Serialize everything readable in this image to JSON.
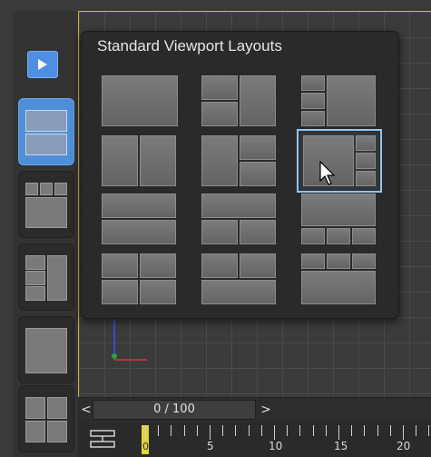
{
  "popup": {
    "title": "Standard Viewport Layouts"
  },
  "timeline": {
    "frame_readout": "0 / 100",
    "prev_label": "<",
    "next_label": ">"
  },
  "ruler": {
    "playhead_frame": "0",
    "labels": [
      "5",
      "10",
      "15",
      "20"
    ]
  },
  "sidebar": {
    "play_button": "play-icon",
    "items": [
      {
        "name": "layout-two-horizontal",
        "active": true
      },
      {
        "name": "layout-three-top-one-bottom",
        "active": false
      },
      {
        "name": "layout-three-left-one-right",
        "active": false
      },
      {
        "name": "layout-single",
        "active": false
      },
      {
        "name": "layout-four",
        "active": false
      }
    ]
  },
  "colors": {
    "accent": "#4f8fd8",
    "selection": "#8fc7f2",
    "playhead": "#e3d43b",
    "viewport_border": "#c9b43a"
  }
}
